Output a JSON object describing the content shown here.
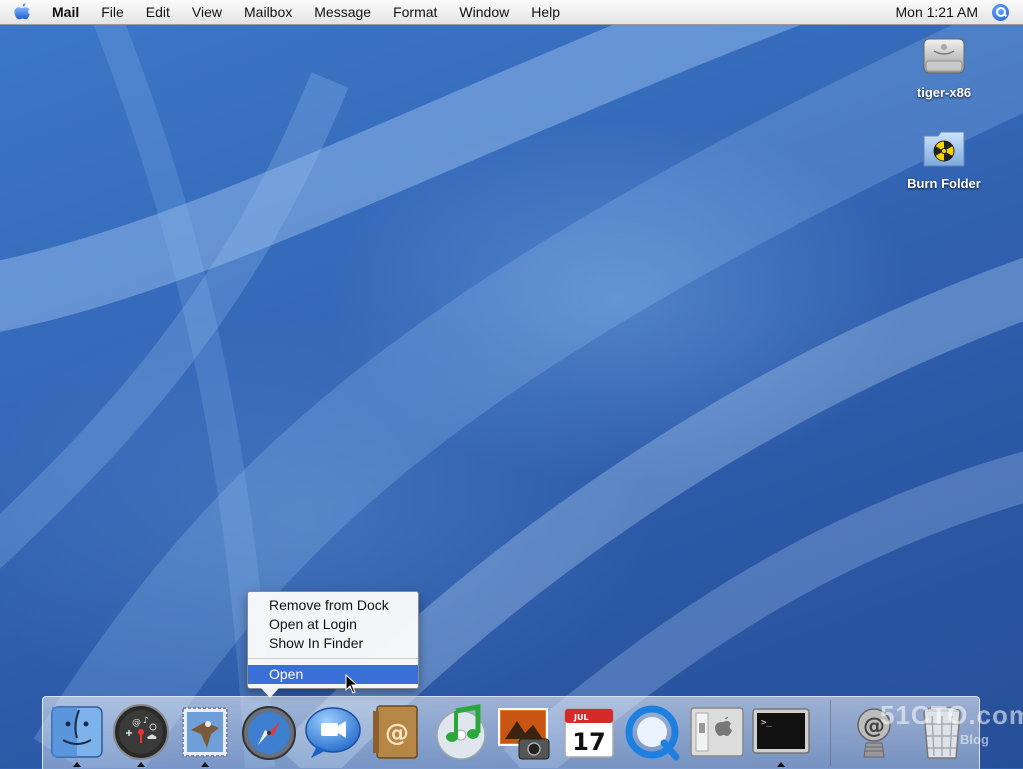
{
  "menubar": {
    "app_name": "Mail",
    "items": [
      "File",
      "Edit",
      "View",
      "Mailbox",
      "Message",
      "Format",
      "Window",
      "Help"
    ],
    "clock": "Mon 1:21 AM",
    "apple_icon": "apple-logo-icon",
    "spotlight_icon": "spotlight-search-icon"
  },
  "desktop": {
    "icons": [
      {
        "label": "tiger-x86",
        "icon": "hard-drive-icon"
      },
      {
        "label": "Burn Folder",
        "icon": "burn-folder-icon"
      }
    ]
  },
  "context_menu": {
    "items": [
      "Remove from Dock",
      "Open at Login",
      "Show In Finder"
    ],
    "selected": "Open"
  },
  "dock": {
    "apps": [
      {
        "name": "Finder",
        "icon": "finder-icon",
        "running": true
      },
      {
        "name": "Dashboard",
        "icon": "dashboard-icon",
        "running": true
      },
      {
        "name": "Mail",
        "icon": "mail-icon",
        "running": true
      },
      {
        "name": "Safari",
        "icon": "safari-icon",
        "running": false
      },
      {
        "name": "iChat",
        "icon": "ichat-icon",
        "running": false
      },
      {
        "name": "Address Book",
        "icon": "address-book-icon",
        "running": false
      },
      {
        "name": "iTunes",
        "icon": "itunes-icon",
        "running": false
      },
      {
        "name": "iPhoto",
        "icon": "iphoto-icon",
        "running": false
      },
      {
        "name": "iCal",
        "icon": "ical-icon",
        "running": false
      },
      {
        "name": "QuickTime Player",
        "icon": "quicktime-icon",
        "running": false
      },
      {
        "name": "System Preferences",
        "icon": "system-preferences-icon",
        "running": false
      },
      {
        "name": "Terminal",
        "icon": "terminal-icon",
        "running": true
      }
    ],
    "others": [
      {
        "name": "Mail Downloads",
        "icon": "at-sign-stack-icon"
      },
      {
        "name": "Trash",
        "icon": "trash-icon"
      }
    ],
    "ical_date": "17",
    "ical_month": "JUL",
    "terminal_prompt": ">_"
  },
  "watermark": {
    "text": "51CTO.com",
    "sub_text": "Blog"
  },
  "colors": {
    "desktop_blue": "#2f62b3",
    "menu_highlight": "#3a6fd8"
  }
}
